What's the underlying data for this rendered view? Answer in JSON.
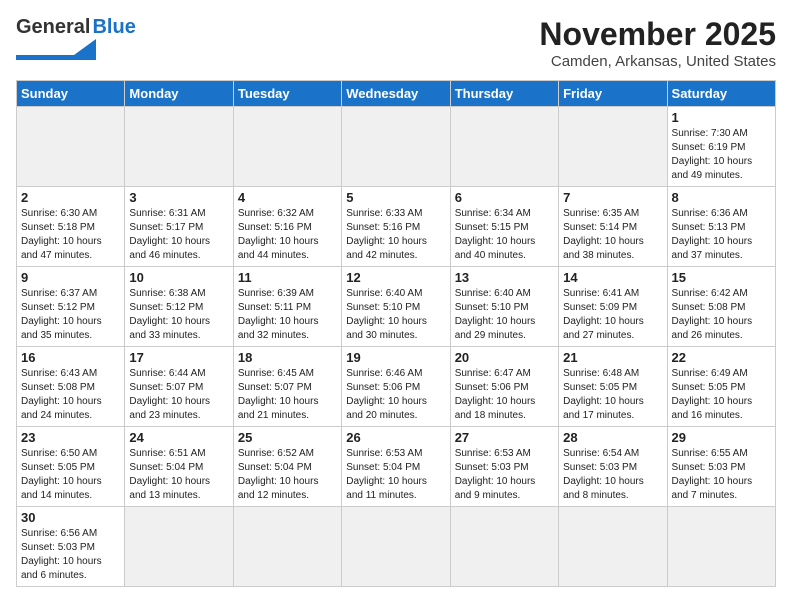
{
  "header": {
    "logo_general": "General",
    "logo_blue": "Blue",
    "month_title": "November 2025",
    "location": "Camden, Arkansas, United States"
  },
  "days_of_week": [
    "Sunday",
    "Monday",
    "Tuesday",
    "Wednesday",
    "Thursday",
    "Friday",
    "Saturday"
  ],
  "weeks": [
    [
      {
        "day": "",
        "empty": true
      },
      {
        "day": "",
        "empty": true
      },
      {
        "day": "",
        "empty": true
      },
      {
        "day": "",
        "empty": true
      },
      {
        "day": "",
        "empty": true
      },
      {
        "day": "",
        "empty": true
      },
      {
        "day": "1",
        "sunrise": "7:30 AM",
        "sunset": "6:19 PM",
        "daylight": "10 hours and 49 minutes."
      }
    ],
    [
      {
        "day": "2",
        "sunrise": "6:30 AM",
        "sunset": "5:18 PM",
        "daylight": "10 hours and 47 minutes."
      },
      {
        "day": "3",
        "sunrise": "6:31 AM",
        "sunset": "5:17 PM",
        "daylight": "10 hours and 46 minutes."
      },
      {
        "day": "4",
        "sunrise": "6:32 AM",
        "sunset": "5:16 PM",
        "daylight": "10 hours and 44 minutes."
      },
      {
        "day": "5",
        "sunrise": "6:33 AM",
        "sunset": "5:16 PM",
        "daylight": "10 hours and 42 minutes."
      },
      {
        "day": "6",
        "sunrise": "6:34 AM",
        "sunset": "5:15 PM",
        "daylight": "10 hours and 40 minutes."
      },
      {
        "day": "7",
        "sunrise": "6:35 AM",
        "sunset": "5:14 PM",
        "daylight": "10 hours and 38 minutes."
      },
      {
        "day": "8",
        "sunrise": "6:36 AM",
        "sunset": "5:13 PM",
        "daylight": "10 hours and 37 minutes."
      }
    ],
    [
      {
        "day": "9",
        "sunrise": "6:37 AM",
        "sunset": "5:12 PM",
        "daylight": "10 hours and 35 minutes."
      },
      {
        "day": "10",
        "sunrise": "6:38 AM",
        "sunset": "5:12 PM",
        "daylight": "10 hours and 33 minutes."
      },
      {
        "day": "11",
        "sunrise": "6:39 AM",
        "sunset": "5:11 PM",
        "daylight": "10 hours and 32 minutes."
      },
      {
        "day": "12",
        "sunrise": "6:40 AM",
        "sunset": "5:10 PM",
        "daylight": "10 hours and 30 minutes."
      },
      {
        "day": "13",
        "sunrise": "6:40 AM",
        "sunset": "5:10 PM",
        "daylight": "10 hours and 29 minutes."
      },
      {
        "day": "14",
        "sunrise": "6:41 AM",
        "sunset": "5:09 PM",
        "daylight": "10 hours and 27 minutes."
      },
      {
        "day": "15",
        "sunrise": "6:42 AM",
        "sunset": "5:08 PM",
        "daylight": "10 hours and 26 minutes."
      }
    ],
    [
      {
        "day": "16",
        "sunrise": "6:43 AM",
        "sunset": "5:08 PM",
        "daylight": "10 hours and 24 minutes."
      },
      {
        "day": "17",
        "sunrise": "6:44 AM",
        "sunset": "5:07 PM",
        "daylight": "10 hours and 23 minutes."
      },
      {
        "day": "18",
        "sunrise": "6:45 AM",
        "sunset": "5:07 PM",
        "daylight": "10 hours and 21 minutes."
      },
      {
        "day": "19",
        "sunrise": "6:46 AM",
        "sunset": "5:06 PM",
        "daylight": "10 hours and 20 minutes."
      },
      {
        "day": "20",
        "sunrise": "6:47 AM",
        "sunset": "5:06 PM",
        "daylight": "10 hours and 18 minutes."
      },
      {
        "day": "21",
        "sunrise": "6:48 AM",
        "sunset": "5:05 PM",
        "daylight": "10 hours and 17 minutes."
      },
      {
        "day": "22",
        "sunrise": "6:49 AM",
        "sunset": "5:05 PM",
        "daylight": "10 hours and 16 minutes."
      }
    ],
    [
      {
        "day": "23",
        "sunrise": "6:50 AM",
        "sunset": "5:05 PM",
        "daylight": "10 hours and 14 minutes."
      },
      {
        "day": "24",
        "sunrise": "6:51 AM",
        "sunset": "5:04 PM",
        "daylight": "10 hours and 13 minutes."
      },
      {
        "day": "25",
        "sunrise": "6:52 AM",
        "sunset": "5:04 PM",
        "daylight": "10 hours and 12 minutes."
      },
      {
        "day": "26",
        "sunrise": "6:53 AM",
        "sunset": "5:04 PM",
        "daylight": "10 hours and 11 minutes."
      },
      {
        "day": "27",
        "sunrise": "6:53 AM",
        "sunset": "5:03 PM",
        "daylight": "10 hours and 9 minutes."
      },
      {
        "day": "28",
        "sunrise": "6:54 AM",
        "sunset": "5:03 PM",
        "daylight": "10 hours and 8 minutes."
      },
      {
        "day": "29",
        "sunrise": "6:55 AM",
        "sunset": "5:03 PM",
        "daylight": "10 hours and 7 minutes."
      }
    ],
    [
      {
        "day": "30",
        "sunrise": "6:56 AM",
        "sunset": "5:03 PM",
        "daylight": "10 hours and 6 minutes."
      },
      {
        "day": "",
        "empty": true
      },
      {
        "day": "",
        "empty": true
      },
      {
        "day": "",
        "empty": true
      },
      {
        "day": "",
        "empty": true
      },
      {
        "day": "",
        "empty": true
      },
      {
        "day": "",
        "empty": true
      }
    ]
  ]
}
